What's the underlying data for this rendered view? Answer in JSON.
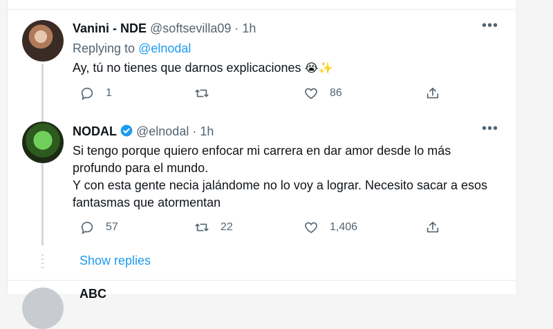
{
  "tweets": [
    {
      "name": "Vanini - NDE",
      "handle": "@softsevilla09",
      "sep": "·",
      "time": "1h",
      "replying_prefix": "Replying to ",
      "replying_handle": "@elnodal",
      "text": "Ay, tú no tienes que darnos explicaciones",
      "emoji": "😭✨",
      "replies": "1",
      "retweets": "",
      "likes": "86"
    },
    {
      "name": "NODAL",
      "handle": "@elnodal",
      "sep": "·",
      "time": "1h",
      "verified": true,
      "lines": [
        "Si tengo porque quiero enfocar mi carrera en dar amor desde lo más",
        "profundo para el mundo.",
        "Y con esta gente necia jalándome no lo voy a lograr. Necesito sacar a esos",
        "fantasmas que atormentan"
      ],
      "replies": "57",
      "retweets": "22",
      "likes": "1,406"
    }
  ],
  "show_replies": "Show replies",
  "next_tweet_partial": "ABC",
  "icons": [
    "reply-icon",
    "retweet-icon",
    "like-icon",
    "share-icon",
    "more-icon",
    "verified-badge-icon"
  ],
  "colors": {
    "accent": "#1d9bf0",
    "muted": "#536471",
    "thread": "#cfd9de"
  }
}
